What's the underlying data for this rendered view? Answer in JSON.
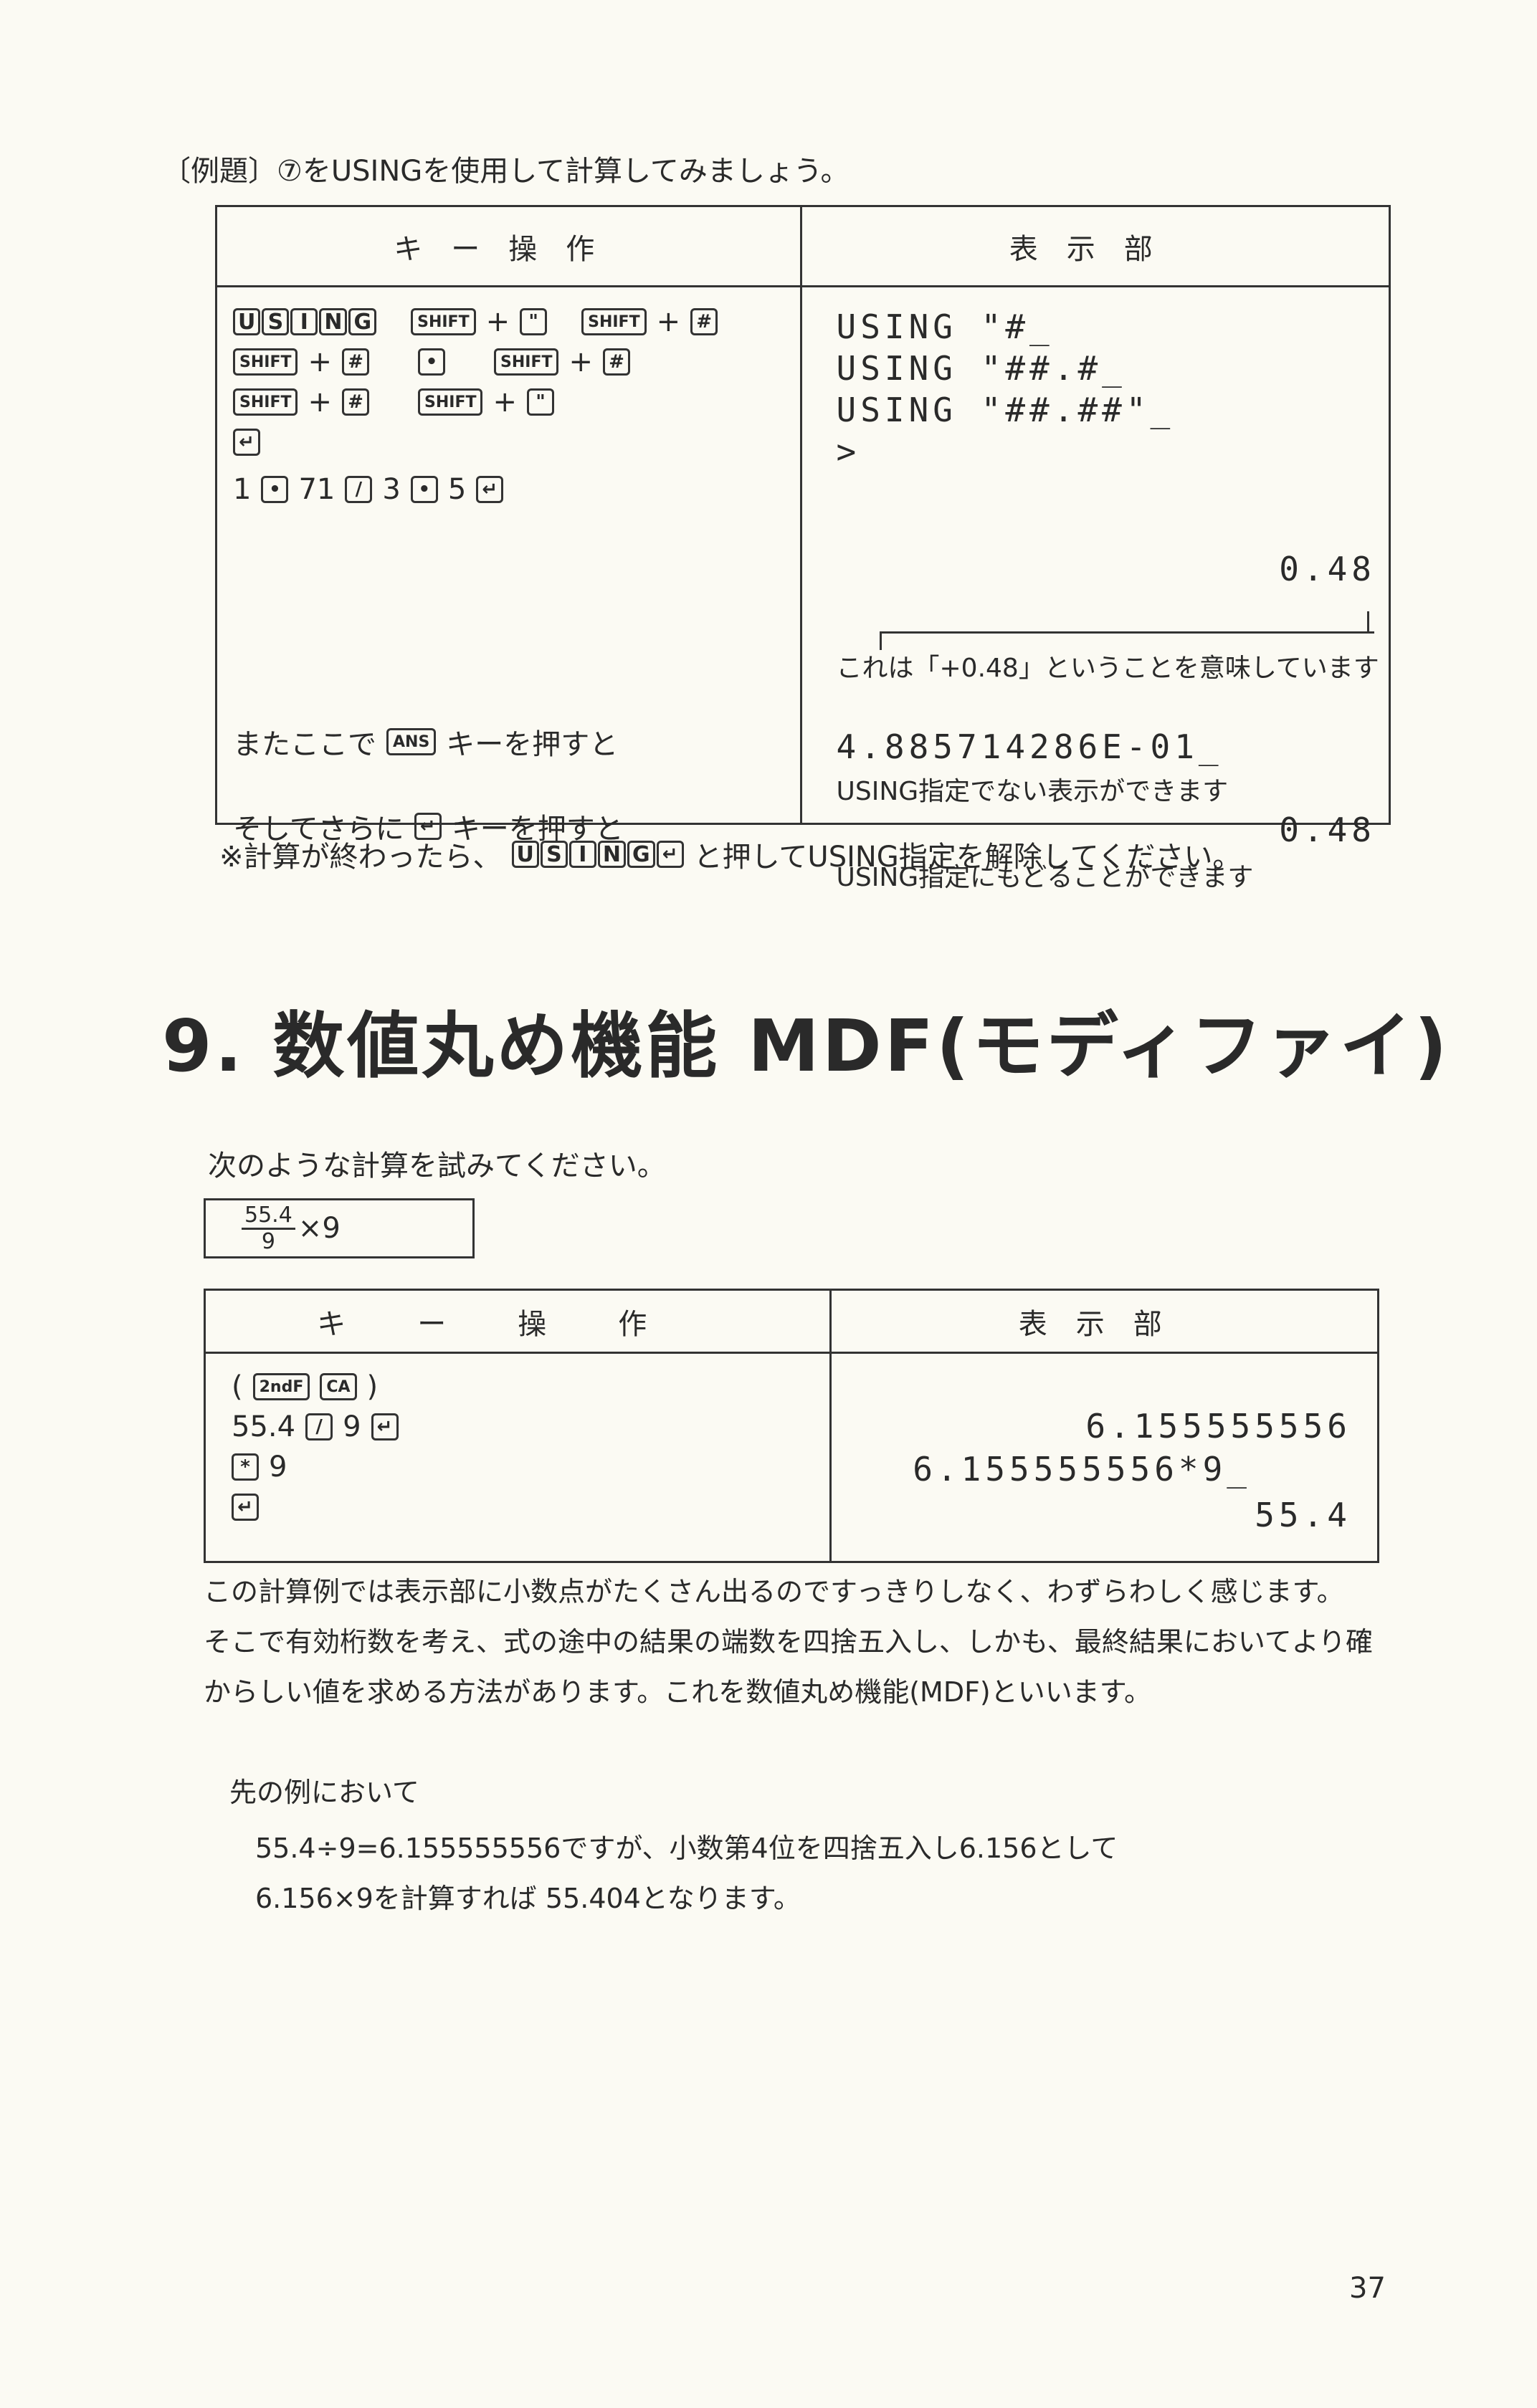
{
  "section1": {
    "intro": "〔例題〕⑦をUSINGを使用して計算してみましょう。",
    "table": {
      "col1_header": "キー操作",
      "col2_header": "表示部",
      "keys": {
        "using_letters": [
          "U",
          "S",
          "I",
          "N",
          "G"
        ],
        "shift": "SHIFT",
        "plus": "+",
        "quote": "\"",
        "hash": "#",
        "dot": "•",
        "enter": "↵",
        "divide": "/",
        "ans": "ANS",
        "digit1": "1",
        "digit71": "71",
        "digit3": "3",
        "digit5": "5"
      },
      "display": {
        "line1": "USING \"#_",
        "line2": "USING \"##.#_",
        "line3": "USING \"##.##\"_",
        "line4": ">",
        "result1": "0.48",
        "result1_note": "これは「+0.48」ということを意味しています",
        "result2": "4.885714286E-01_",
        "result2_note": "USING指定でない表示ができます",
        "result3": "0.48",
        "result3_note": "USING指定にもどることができます"
      },
      "row_text": {
        "ans_prefix": "またここで",
        "ans_suffix": "キーを押すと",
        "enter_prefix": "そしてさらに",
        "enter_suffix": "キーを押すと"
      }
    },
    "footnote_prefix": "※計算が終わったら、",
    "footnote_suffix": "と押してUSING指定を解除してください。"
  },
  "section2": {
    "title": "9. 数値丸め機能 MDF(モディファイ)",
    "instruction": "次のような計算を試みてください。",
    "formula": {
      "numerator": "55.4",
      "denominator": "9",
      "rest": "×9"
    },
    "table": {
      "col1_header": "キー操作",
      "col2_header": "表示部",
      "row1": {
        "open": "(",
        "k1": "2ndF",
        "k2": "CA",
        "close": ")"
      },
      "row2": {
        "prefix": "55.4",
        "div": "/",
        "nine": "9",
        "enter": "↵"
      },
      "row3": {
        "mul": "*",
        "nine": "9"
      },
      "row4": {
        "enter": "↵"
      },
      "display": {
        "line1": "6.155555556",
        "line2": "6.155555556*9_",
        "line3": "55.4"
      }
    },
    "para1": "この計算例では表示部に小数点がたくさん出るのですっきりしなく、わずらわしく感じます。",
    "para2": "そこで有効桁数を考え、式の途中の結果の端数を四捨五入し、しかも、最終結果においてより確",
    "para3": "からしい値を求める方法があります。これを数値丸め機能(MDF)といいます。",
    "example_intro": "先の例において",
    "example_line1": "55.4÷9=6.155555556ですが、小数第4位を四捨五入し6.156として",
    "example_line2": "6.156×9を計算すれば 55.404となります。"
  },
  "page_number": "37"
}
